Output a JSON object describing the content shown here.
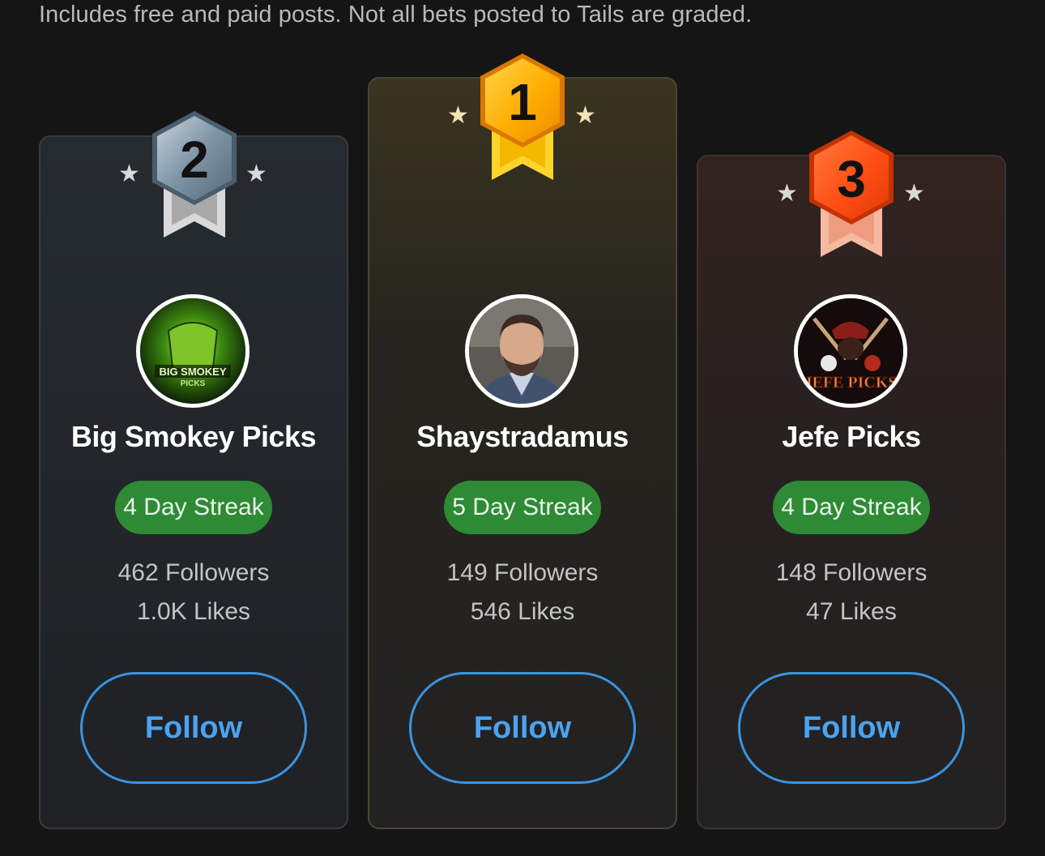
{
  "header": {
    "subtitle": "Includes free and paid posts. Not all bets posted to Tails are graded."
  },
  "leaderboard": [
    {
      "rank": "2",
      "tier": "silver",
      "name": "Big Smokey Picks",
      "streak": "4 Day Streak",
      "followers": "462 Followers",
      "likes": "1.0K Likes",
      "follow_label": "Follow",
      "avatar_text": "BIG SMOKEY",
      "avatar_subtext": "PICKS"
    },
    {
      "rank": "1",
      "tier": "gold",
      "name": "Shaystradamus",
      "streak": "5 Day Streak",
      "followers": "149 Followers",
      "likes": "546 Likes",
      "follow_label": "Follow"
    },
    {
      "rank": "3",
      "tier": "bronze",
      "name": "Jefe Picks",
      "streak": "4 Day Streak",
      "followers": "148 Followers",
      "likes": "47 Likes",
      "follow_label": "Follow",
      "avatar_text": "JEFE PICKS"
    }
  ],
  "colors": {
    "streak_green": "#2e8a35",
    "follow_blue": "#3a93e0",
    "gold": "#ffb300",
    "silver": "#8fa3b2",
    "bronze": "#ff5a1f"
  },
  "icons": {
    "star": "★",
    "medal": "hexagon-medal-icon"
  }
}
